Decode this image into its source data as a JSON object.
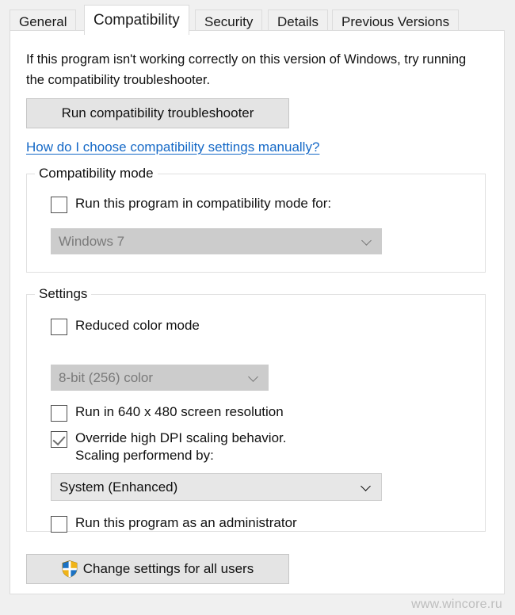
{
  "dialog": {
    "tabs": [
      {
        "label": "General",
        "active": false
      },
      {
        "label": "Compatibility",
        "active": true
      },
      {
        "label": "Security",
        "active": false
      },
      {
        "label": "Details",
        "active": false
      },
      {
        "label": "Previous Versions",
        "active": false
      }
    ]
  },
  "intro": {
    "text": "If this program isn't working correctly on this version of Windows, try running the compatibility troubleshooter."
  },
  "troubleshooter": {
    "button_label": "Run compatibility troubleshooter",
    "help_link_label": "How do I choose compatibility settings manually? "
  },
  "compatibility_mode": {
    "group_title": "Compatibility mode",
    "checkbox_label": "Run this program in compatibility mode for:",
    "checkbox_checked": false,
    "os_value": "Windows 7",
    "os_disabled": true
  },
  "settings": {
    "group_title": "Settings",
    "reduced_color": {
      "label": "Reduced color mode",
      "checked": false
    },
    "color_depth_value": "8-bit (256) color",
    "color_depth_disabled": true,
    "low_resolution": {
      "label": "Run in 640 x 480 screen resolution",
      "checked": false
    },
    "dpi_override": {
      "label": "Override high DPI scaling behavior.\nScaling performend by:",
      "checked": true
    },
    "scaling_value": "System (Enhanced)",
    "scaling_disabled": false,
    "run_as_admin": {
      "label": "Run this program as an administrator",
      "checked": false
    }
  },
  "footer": {
    "change_all_users_label": "Change settings for all users",
    "shield_icon": "uac-shield-icon"
  },
  "watermark": {
    "text": "www.wincore.ru"
  },
  "colors": {
    "accent_link": "#1569c7",
    "shield_blue": "#1b72c4",
    "shield_gold": "#f0b418",
    "panel_bg": "#ffffff",
    "dialog_bg": "#f0f0f0",
    "disabled_control_bg": "#cccccc"
  }
}
